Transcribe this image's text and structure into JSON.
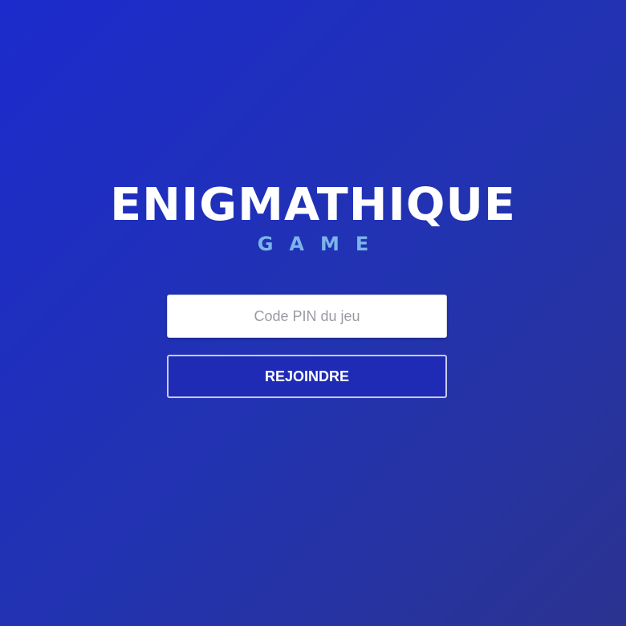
{
  "logo": {
    "title": "ENIGMATHIQUE",
    "subtitle": "GAME"
  },
  "join_form": {
    "pin_placeholder": "Code PIN du jeu",
    "pin_value": "",
    "join_label": "REJOINDRE"
  },
  "colors": {
    "background_start": "#1c2bcc",
    "background_end": "#2b3390",
    "logo_title": "#ffffff",
    "logo_subtitle": "#7cb4ea",
    "button_border": "#c7cbe8"
  }
}
